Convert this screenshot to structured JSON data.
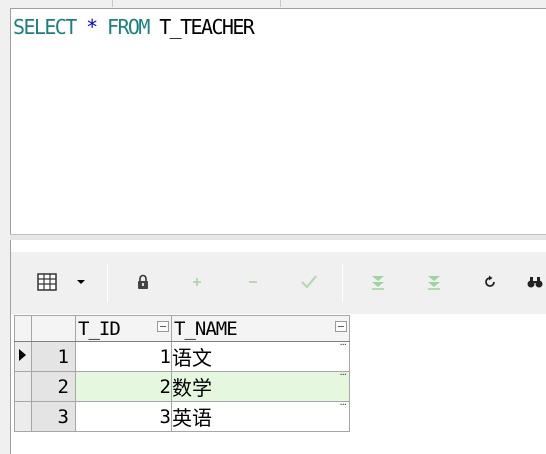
{
  "editor": {
    "sql": {
      "kw1": "SELECT",
      "star": "*",
      "kw2": "FROM",
      "table": "T_TEACHER"
    }
  },
  "toolbar": {
    "buttons": [
      {
        "name": "grid-view-icon"
      },
      {
        "name": "dropdown-arrow-icon"
      },
      {
        "name": "lock-icon"
      },
      {
        "name": "add-record-icon",
        "label": "+"
      },
      {
        "name": "delete-record-icon",
        "label": "−"
      },
      {
        "name": "post-edit-icon",
        "label": "✓"
      },
      {
        "name": "fetch-next-icon"
      },
      {
        "name": "fetch-all-icon"
      },
      {
        "name": "refresh-icon"
      },
      {
        "name": "search-icon"
      }
    ],
    "colors": {
      "disabled": "#b4d7b4",
      "enabled": "#303030"
    }
  },
  "grid": {
    "columns": [
      "T_ID",
      "T_NAME"
    ],
    "rows": [
      {
        "num": "1",
        "id": "1",
        "name": "语文"
      },
      {
        "num": "2",
        "id": "2",
        "name": "数学"
      },
      {
        "num": "3",
        "id": "3",
        "name": "英语"
      }
    ],
    "ellipsis": "···"
  }
}
